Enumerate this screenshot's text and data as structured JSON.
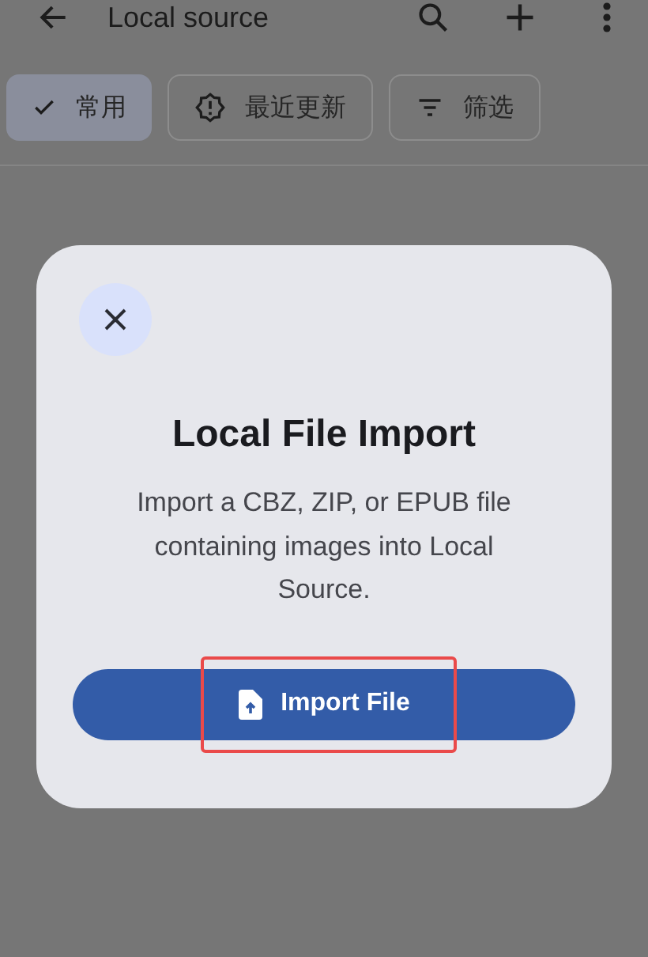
{
  "top_bar": {
    "title": "Local source"
  },
  "chips": [
    {
      "label": "常用",
      "selected": true,
      "kind": "check"
    },
    {
      "label": "最近更新",
      "selected": false,
      "kind": "alert"
    },
    {
      "label": "筛选",
      "selected": false,
      "kind": "filter"
    }
  ],
  "dialog": {
    "title": "Local File Import",
    "body": "Import a CBZ, ZIP, or EPUB file containing images into Local Source.",
    "button": {
      "label": "Import File",
      "highlighted": true
    }
  }
}
